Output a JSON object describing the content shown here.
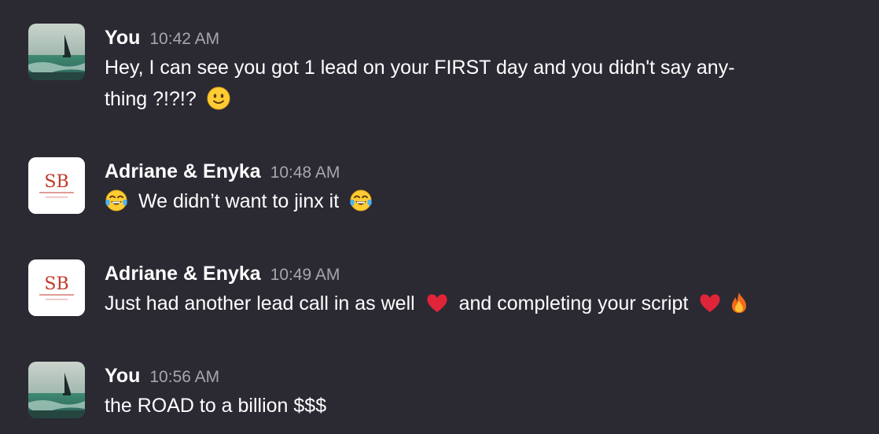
{
  "messages": [
    {
      "author": "You",
      "time": "10:42 AM",
      "text_line1": "Hey, I can see you got 1 lead on your FIRST day and you didn't say any-",
      "text_line2": "thing ?!?!?",
      "avatar": "landscape-photo",
      "emoji": [
        "slightly-smiling-face-icon"
      ]
    },
    {
      "author": "Adriane & Enyka",
      "time": "10:48 AM",
      "text": "We didn’t want to jinx it",
      "avatar": "sb-logo",
      "avatar_logo_text": "SB",
      "emoji": [
        "tears-of-joy-icon",
        "tears-of-joy-icon"
      ]
    },
    {
      "author": "Adriane & Enyka",
      "time": "10:49 AM",
      "text_part1": "Just had another lead call in as well",
      "text_part2": "and completing your script",
      "avatar": "sb-logo",
      "avatar_logo_text": "SB",
      "emoji": [
        "red-heart-icon",
        "red-heart-icon",
        "fire-icon"
      ]
    },
    {
      "author": "You",
      "time": "10:56 AM",
      "text": "the ROAD to a billion $$$",
      "avatar": "landscape-photo",
      "emoji": []
    }
  ],
  "colors": {
    "background": "#2b2a33",
    "text": "#ffffff",
    "timestamp": "#a7a6ae",
    "heart": "#e0243a",
    "emoji_face": "#ffcc33"
  }
}
